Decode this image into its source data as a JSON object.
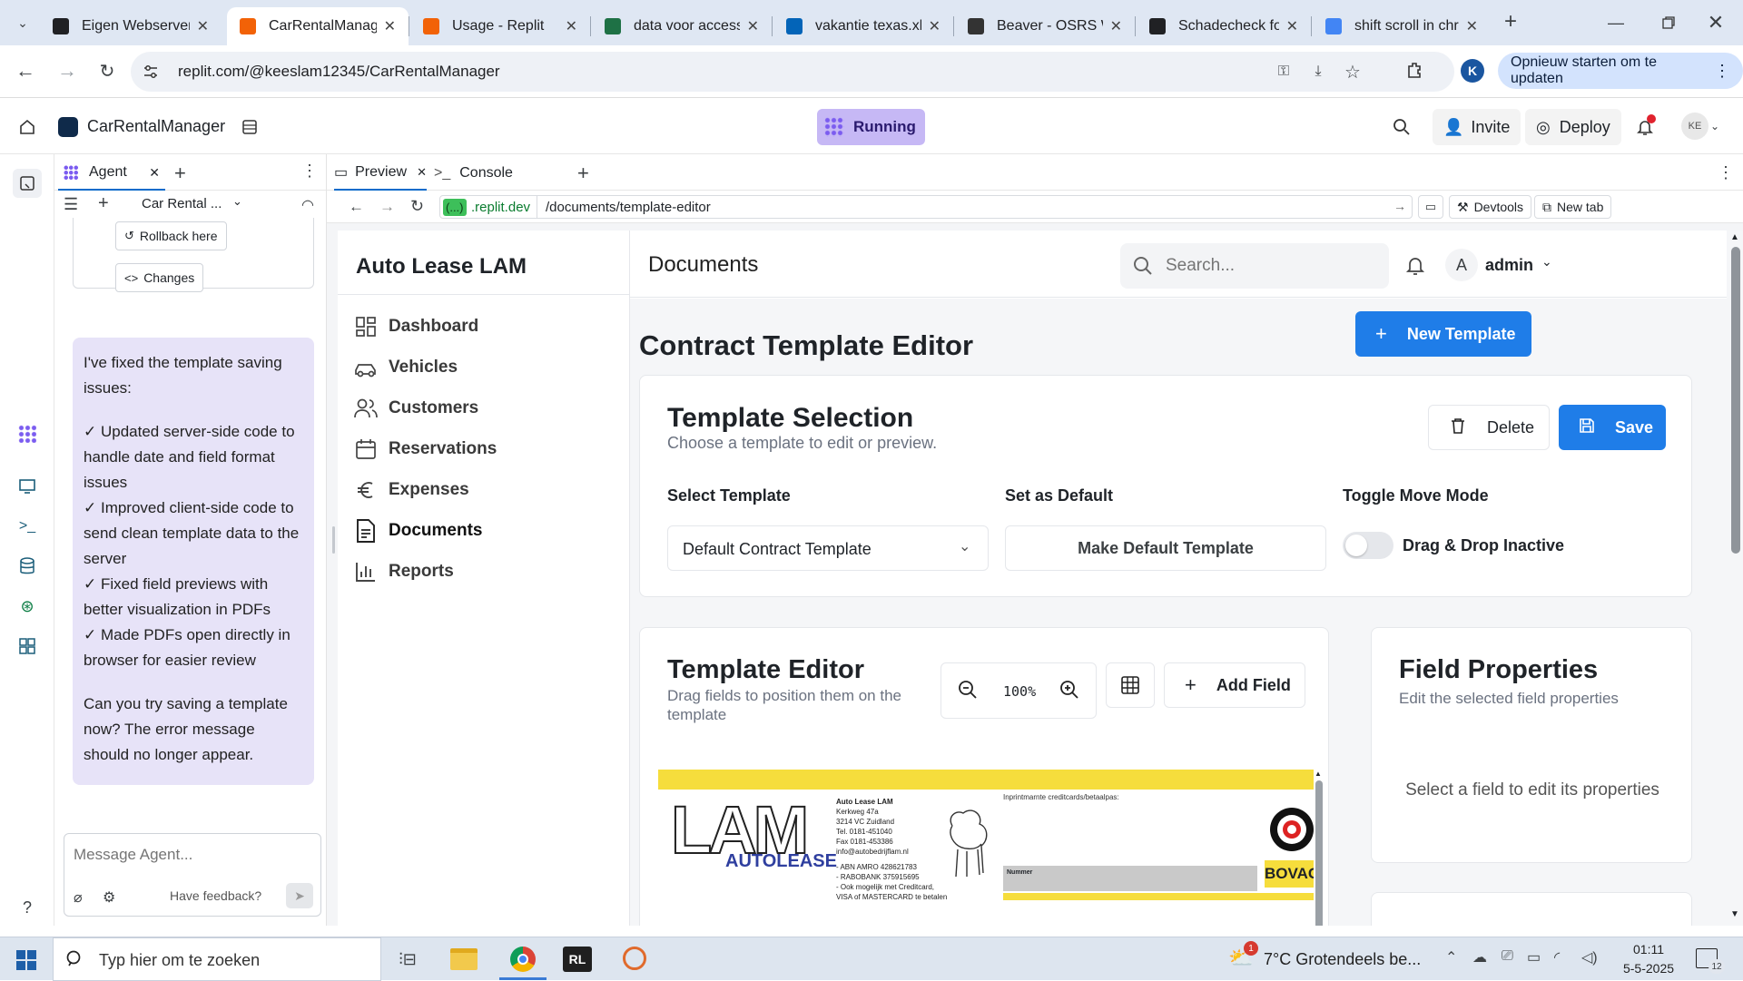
{
  "browser": {
    "tabs": [
      {
        "title": "Eigen Webserver",
        "color": "#202124"
      },
      {
        "title": "CarRentalManager",
        "color": "#f26207"
      },
      {
        "title": "Usage - Replit",
        "color": "#f26207"
      },
      {
        "title": "data voor access",
        "color": "#1e7145"
      },
      {
        "title": "vakantie texas.xls",
        "color": "#0364b8"
      },
      {
        "title": "Beaver - OSRS W",
        "color": "#333333"
      },
      {
        "title": "Schadecheck for",
        "color": "#202124"
      },
      {
        "title": "shift scroll in chr",
        "color": "#4285f4"
      }
    ],
    "url": "replit.com/@keeslam12345/CarRentalManager",
    "update_button": "Opnieuw starten om te updaten",
    "profile_letter": "K"
  },
  "replit": {
    "project_name": "CarRentalManager",
    "status": "Running",
    "invite": "Invite",
    "deploy": "Deploy",
    "avatar": "KE"
  },
  "agent": {
    "tab_label": "Agent",
    "thread_title": "Car Rental ...",
    "rollback": "Rollback here",
    "changes": "Changes",
    "message_paragraphs": [
      "I've fixed the template saving issues:",
      "✓ Updated server-side code to handle date and field format issues\n✓ Improved client-side code to send clean template data to the server\n✓ Fixed field previews with better visualization in PDFs\n✓ Made PDFs open directly in browser for easier review",
      "Can you try saving a template now? The error message should no longer appear."
    ],
    "input_placeholder": "Message Agent...",
    "feedback": "Have feedback?"
  },
  "preview": {
    "tab_preview": "Preview",
    "tab_console": "Console",
    "domain": ".replit.dev",
    "domain_badge": "(...)",
    "path": "/documents/template-editor",
    "devtools": "Devtools",
    "new_tab": "New tab"
  },
  "app": {
    "brand": "Auto Lease LAM",
    "nav": [
      "Dashboard",
      "Vehicles",
      "Customers",
      "Reservations",
      "Expenses",
      "Documents",
      "Reports"
    ],
    "active_nav": "Documents",
    "header_title": "Documents",
    "search_placeholder": "Search...",
    "user_initial": "A",
    "user_name": "admin",
    "page_title": "Contract Template Editor",
    "new_template": "New Template",
    "selection": {
      "title": "Template Selection",
      "subtitle": "Choose a template to edit or preview.",
      "delete": "Delete",
      "save": "Save",
      "select_label": "Select Template",
      "select_value": "Default Contract Template",
      "default_label": "Set as Default",
      "default_button": "Make Default Template",
      "toggle_label": "Toggle Move Mode",
      "toggle_text": "Drag & Drop Inactive"
    },
    "editor": {
      "title": "Template Editor",
      "subtitle": "Drag fields to position them on the template",
      "zoom": "100%",
      "add_field": "Add Field"
    },
    "properties": {
      "title": "Field Properties",
      "subtitle": "Edit the selected field properties",
      "empty": "Select a field to edit its properties"
    },
    "doc": {
      "logo_text": "LAM",
      "logo_sub": "AUTOLEASE",
      "company_lines": [
        "Auto Lease LAM",
        "Kerkweg 47a",
        "3214 VC Zuidland",
        "Tel. 0181-451040",
        "Fax 0181-453386",
        "info@autobedrijflam.nl"
      ],
      "bank_lines": [
        "- ABN AMRO 428621783",
        "- RABOBANK 375915695",
        "- Ook mogelijk met Creditcard,",
        "VISA of MASTERCARD te betalen"
      ],
      "imprint": "Inprintmarnte creditcards/betaalpas:",
      "nummer": "Nummer",
      "bovag": "BOVAG"
    }
  },
  "taskbar": {
    "search_placeholder": "Typ hier om te zoeken",
    "weather": "7°C  Grotendeels be...",
    "weather_badge": "1",
    "time": "01:11",
    "date": "5-5-2025",
    "notif_count": "12"
  }
}
